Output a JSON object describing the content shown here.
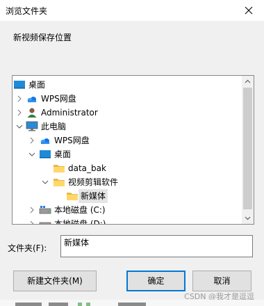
{
  "window": {
    "title": "浏览文件夹"
  },
  "instruction": "新视频保存位置",
  "tree": {
    "nodes": [
      {
        "label": "桌面",
        "icon": "desktop-icon",
        "expander": "none"
      },
      {
        "label": "WPS网盘",
        "icon": "cloud-icon",
        "expander": "collapsed"
      },
      {
        "label": "Administrator",
        "icon": "user-icon",
        "expander": "collapsed"
      },
      {
        "label": "此电脑",
        "icon": "computer-icon",
        "expander": "expanded"
      },
      {
        "label": "WPS网盘",
        "icon": "cloud-icon",
        "expander": "collapsed"
      },
      {
        "label": "桌面",
        "icon": "desktop-icon",
        "expander": "expanded"
      },
      {
        "label": "data_bak",
        "icon": "folder-icon",
        "expander": "none"
      },
      {
        "label": "视频剪辑软件",
        "icon": "folder-icon",
        "expander": "expanded"
      },
      {
        "label": "新媒体",
        "icon": "folder-icon",
        "expander": "none",
        "selected": true
      },
      {
        "label": "本地磁盘 (C:)",
        "icon": "drive-icon",
        "expander": "collapsed"
      },
      {
        "label": "本地磁盘 (D:)",
        "icon": "drive-icon",
        "expander": "collapsed"
      }
    ]
  },
  "folder": {
    "label": "文件夹(F):",
    "value": "新媒体"
  },
  "buttons": {
    "new_folder": "新建文件夹(M)",
    "ok": "确定",
    "cancel": "取消"
  },
  "watermark": "CSDN @我才是逗逗"
}
